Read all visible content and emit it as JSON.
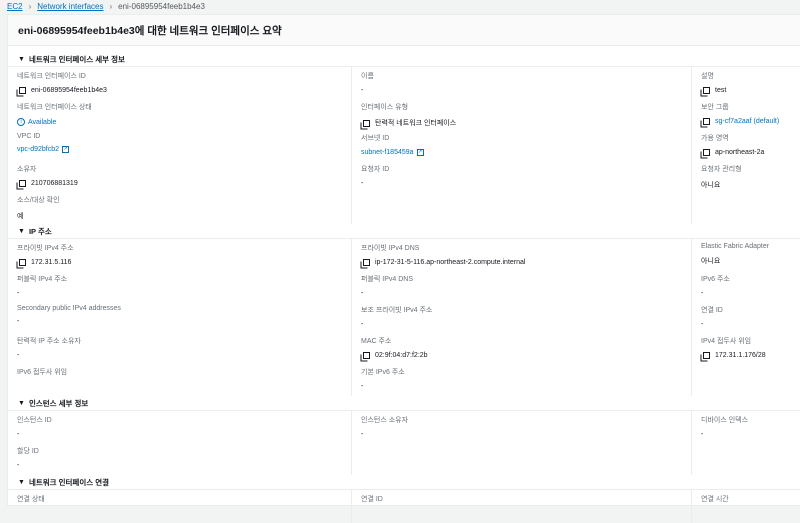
{
  "breadcrumb": [
    "EC2",
    "Network interfaces",
    "eni-06895954feeb1b4e3"
  ],
  "title": "eni-06895954feeb1b4e3에 대한 네트워크 인터페이스 요약",
  "sections": [
    {
      "title": "네트워크 인터페이스 세부 정보",
      "columns": [
        [
          {
            "label": "네트워크 인터페이스 ID",
            "value": "eni-06895954feeb1b4e3",
            "type": "copy"
          },
          {
            "label": "네트워크 인터페이스 상태",
            "value": "Available",
            "type": "status"
          },
          {
            "label": "VPC ID",
            "value": "vpc-d92bfcb2",
            "type": "link"
          },
          {
            "label": "소유자",
            "value": "210706881319",
            "type": "copy"
          },
          {
            "label": "소스/대상 확인",
            "value": "예",
            "type": "plain"
          }
        ],
        [
          {
            "label": "이름",
            "value": "-",
            "type": "plain"
          },
          {
            "label": "인터페이스 유형",
            "value": "탄력적 네트워크 인터페이스",
            "type": "copy"
          },
          {
            "label": "서브넷 ID",
            "value": "subnet-f185459a",
            "type": "link"
          },
          {
            "label": "요청자 ID",
            "value": "-",
            "type": "plain"
          }
        ],
        [
          {
            "label": "설명",
            "value": "test",
            "type": "copy"
          },
          {
            "label": "보안 그룹",
            "value": "sg-cf7a2aaf (default)",
            "type": "copylink"
          },
          {
            "label": "가용 영역",
            "value": "ap-northeast-2a",
            "type": "copy"
          },
          {
            "label": "요청자 관리형",
            "value": "아니요",
            "type": "plain"
          }
        ]
      ]
    },
    {
      "title": "IP 주소",
      "columns": [
        [
          {
            "label": "프라이빗 IPv4 주소",
            "value": "172.31.5.116",
            "type": "copy"
          },
          {
            "label": "퍼블릭 IPv4 주소",
            "value": "-",
            "type": "plain"
          },
          {
            "label": "Secondary public IPv4 addresses",
            "value": "-",
            "type": "plain"
          },
          {
            "label": "탄력적 IP 주소 소유자",
            "value": "-",
            "type": "plain"
          },
          {
            "label": "IPv6 접두사 위임",
            "value": "",
            "type": "plain"
          }
        ],
        [
          {
            "label": "프라이빗 IPv4 DNS",
            "value": "ip-172-31-5-116.ap-northeast-2.compute.internal",
            "type": "copy"
          },
          {
            "label": "퍼블릭 IPv4 DNS",
            "value": "-",
            "type": "plain"
          },
          {
            "label": "보조 프라이빗 IPv4 주소",
            "value": "-",
            "type": "plain"
          },
          {
            "label": "MAC 주소",
            "value": "02:9f:04:d7:f2:2b",
            "type": "copy"
          },
          {
            "label": "기본 IPv6 주소",
            "value": "-",
            "type": "plain"
          }
        ],
        [
          {
            "label": "Elastic Fabric Adapter",
            "value": "아니요",
            "type": "plain"
          },
          {
            "label": "IPv6 주소",
            "value": "-",
            "type": "plain"
          },
          {
            "label": "연결 ID",
            "value": "-",
            "type": "plain"
          },
          {
            "label": "IPv4 접두사 위임",
            "value": "172.31.1.176/28",
            "type": "copy"
          }
        ]
      ]
    },
    {
      "title": "인스턴스 세부 정보",
      "columns": [
        [
          {
            "label": "인스턴스 ID",
            "value": "-",
            "type": "plain"
          },
          {
            "label": "할당 ID",
            "value": "-",
            "type": "plain"
          }
        ],
        [
          {
            "label": "인스턴스 소유자",
            "value": "-",
            "type": "plain"
          }
        ],
        [
          {
            "label": "디바이스 인덱스",
            "value": "-",
            "type": "plain"
          }
        ]
      ]
    },
    {
      "title": "네트워크 인터페이스 연결",
      "columns": [
        [
          {
            "label": "연결 상태",
            "value": "",
            "type": "plain"
          }
        ],
        [
          {
            "label": "연결 ID",
            "value": "",
            "type": "plain"
          }
        ],
        [
          {
            "label": "연결 시간",
            "value": "",
            "type": "plain"
          }
        ]
      ]
    }
  ]
}
